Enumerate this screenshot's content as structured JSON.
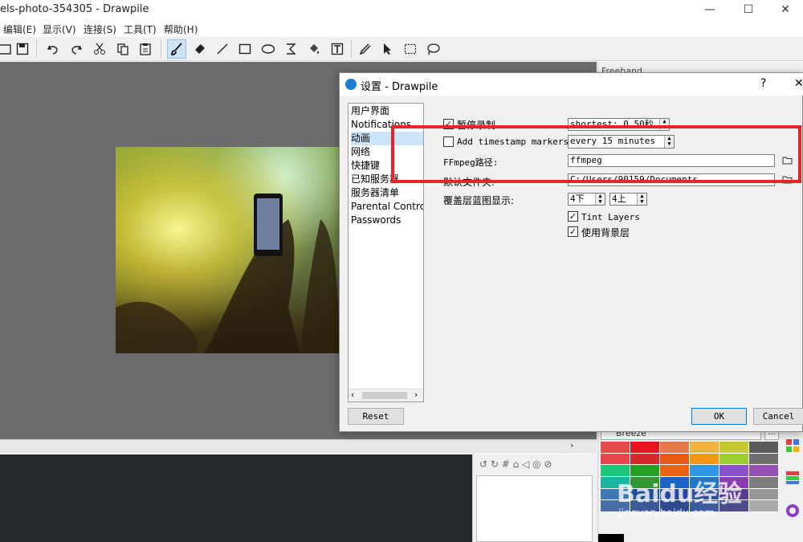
{
  "window": {
    "title": "els-photo-354305 - Drawpile",
    "minimize": "—",
    "maximize": "☐",
    "close": "✕"
  },
  "menubar": [
    "编辑(E)",
    "显示(V)",
    "连接(S)",
    "工具(T)",
    "帮助(H)"
  ],
  "toolbar": {
    "icons": [
      "open-icon",
      "save-icon",
      "undo-icon",
      "redo-icon",
      "cut-icon",
      "copy-icon",
      "paste-icon",
      "brush-icon",
      "eraser-icon",
      "line-icon",
      "rectangle-icon",
      "ellipse-icon",
      "bezier-icon",
      "fill-icon",
      "text-icon",
      "color-picker-icon",
      "select-arrow-icon",
      "rect-select-icon",
      "lasso-icon"
    ],
    "active": "brush-icon"
  },
  "dock": {
    "top_tab_label": "Freehand",
    "palette_name": "Breeze",
    "palette_colors": [
      "#e84a4a",
      "#e8141e",
      "#e8784a",
      "#f2b23c",
      "#c8c832",
      "#5a5a5a",
      "#e8464f",
      "#d42a2a",
      "#e85a14",
      "#f29614",
      "#9acd32",
      "#6e6e6e",
      "#1ec87a",
      "#28a028",
      "#e86414",
      "#3296e6",
      "#8c50c8",
      "#9650b4",
      "#1eb4a0",
      "#329632",
      "#1e64c8",
      "#1e78c8",
      "#8c3cb4",
      "#7d7d7d",
      "#3c78b4",
      "#1e5096",
      "#2846a0",
      "#3250a0",
      "#5a3c8c",
      "#969696",
      "#4a6ea8",
      "#3c5a96",
      "#2e4a8c",
      "#3c5aa0",
      "#4c4c8c",
      "#aaaaaa"
    ]
  },
  "dialog": {
    "title": "设置 - Drawpile",
    "help": "?",
    "close": "✕",
    "categories": [
      {
        "label": "用户界面",
        "selected": false
      },
      {
        "label": "Notifications",
        "selected": false
      },
      {
        "label": "动画",
        "selected": true
      },
      {
        "label": "网络",
        "selected": false
      },
      {
        "label": "快捷键",
        "selected": false
      },
      {
        "label": "已知服务器",
        "selected": false
      },
      {
        "label": "服务器清单",
        "selected": false
      },
      {
        "label": "Parental Controls",
        "selected": false
      },
      {
        "label": "Passwords",
        "selected": false
      }
    ],
    "pause_recording": {
      "label": "暂停录制",
      "checked": true,
      "value": "shortest: 0.50秒"
    },
    "timestamp_markers": {
      "label": "Add timestamp markers",
      "checked": false,
      "value": "every 15 minutes"
    },
    "ffmpeg_path": {
      "label": "FFmpeg路径:",
      "value": "ffmpeg"
    },
    "default_folder": {
      "label": "默认文件夹:",
      "value": "C:/Users/90159/Documents"
    },
    "overlay": {
      "label": "覆盖层蓝图显示:",
      "first": "4下",
      "second": "4上"
    },
    "tint_layers": {
      "label": "Tint Layers",
      "checked": true
    },
    "use_background": {
      "label": "使用背景层",
      "checked": true
    },
    "buttons": {
      "reset": "Reset",
      "ok": "OK",
      "cancel": "Cancel"
    }
  },
  "watermark": {
    "brand": "Baidu经验",
    "url": "jingyan.baidu.com"
  }
}
